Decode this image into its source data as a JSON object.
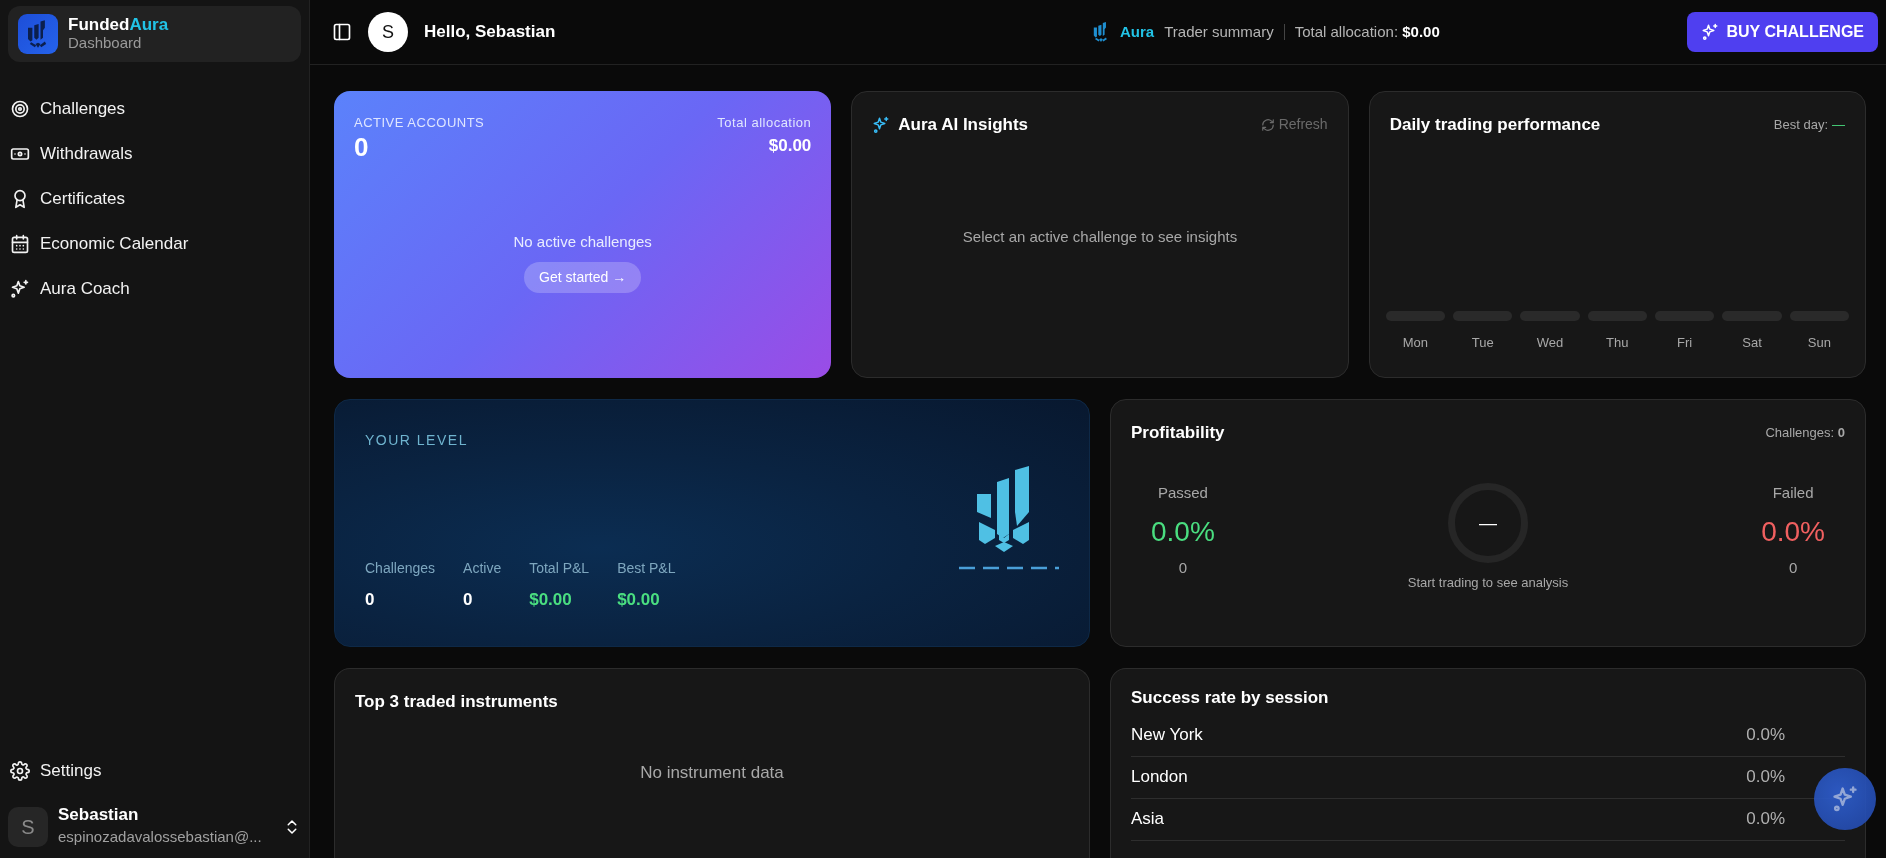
{
  "sidebar": {
    "brand": {
      "name": "Funded",
      "name_accent": "Aura",
      "subtitle": "Dashboard"
    },
    "items": [
      {
        "label": "Challenges"
      },
      {
        "label": "Withdrawals"
      },
      {
        "label": "Certificates"
      },
      {
        "label": "Economic Calendar"
      },
      {
        "label": "Aura Coach"
      }
    ],
    "settings": {
      "label": "Settings"
    },
    "user": {
      "avatar": "S",
      "name": "Sebastian",
      "email": "espinozadavalossebastian@..."
    }
  },
  "topbar": {
    "avatar": "S",
    "greeting": "Hello, Sebastian",
    "summary": {
      "brand": "Aura",
      "label": "Trader summary",
      "allocation": "Total allocation: **$0.00**"
    },
    "button": "BUY CHALLENGE"
  },
  "active_accounts": {
    "label": "ACTIVE ACCOUNTS",
    "count": "0",
    "allocation_label": "Total allocation",
    "allocation": "$0.00",
    "empty": "No active challenges",
    "button": "Get started →"
  },
  "insights": {
    "title": "Aura AI Insights",
    "refresh": {
      "label": "Refresh",
      "disabled": true
    },
    "empty": "Select an active challenge to see insights"
  },
  "daily": {
    "title": "Daily trading performance",
    "best_day_label": "Best day:",
    "best_day": "—",
    "days": [
      "Mon",
      "Tue",
      "Wed",
      "Thu",
      "Fri",
      "Sat",
      "Sun"
    ]
  },
  "level": {
    "title": "YOUR LEVEL",
    "stats": [
      {
        "label": "Challenges",
        "value": "0",
        "kind": "count"
      },
      {
        "label": "Active",
        "value": "0",
        "kind": "count"
      },
      {
        "label": "Total P&L",
        "value": "$0.00",
        "kind": "money"
      },
      {
        "label": "Best P&L",
        "value": "$0.00",
        "kind": "money"
      }
    ]
  },
  "profitability": {
    "title": "Profitability",
    "challenges": "Challenges: **0**",
    "passed": {
      "label": "Passed",
      "percent": "0.0%",
      "count": "0"
    },
    "center": "—",
    "caption": "Start trading to see analysis",
    "failed": {
      "label": "Failed",
      "percent": "0.0%",
      "count": "0"
    }
  },
  "instruments": {
    "title": "Top 3 traded instruments",
    "empty": "No instrument data"
  },
  "sessions": {
    "title": "Success rate by session",
    "rows": [
      {
        "name": "New York",
        "rate": "0.0%"
      },
      {
        "name": "London",
        "rate": "0.0%"
      },
      {
        "name": "Asia",
        "rate": "0.0%"
      }
    ]
  }
}
